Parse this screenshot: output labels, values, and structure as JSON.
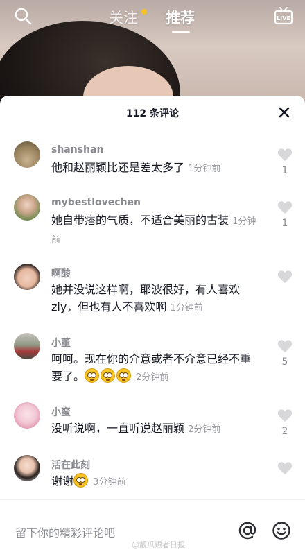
{
  "top_nav": {
    "tabs": [
      {
        "label": "关注",
        "has_dot": true
      },
      {
        "label": "推荐",
        "active": true
      }
    ],
    "icons": [
      "search-icon",
      "live-icon"
    ],
    "dot_color": "#f6c324"
  },
  "comments_sheet": {
    "count_label": "112 条评论",
    "comments": [
      {
        "username": "shanshan",
        "text": "他和赵丽颖比还是差太多了",
        "time": "1分钟前",
        "likes": "1",
        "emojis": 0
      },
      {
        "username": "mybestlovechen",
        "text": "她自带痞的气质，不适合美丽的古装",
        "time": "1分钟前",
        "likes": "1",
        "emojis": 0
      },
      {
        "username": "啊酸",
        "text": "她并没说这样啊，耶波很好，有人喜欢zly，但也有人不喜欢啊",
        "time": "1分钟前",
        "likes": "",
        "emojis": 0
      },
      {
        "username": "小董",
        "text": "呵呵。现在你的介意或者不介意已经不重要了。",
        "time": "2分钟前",
        "likes": "5",
        "emojis": 3
      },
      {
        "username": "小蛮",
        "text": "没听说啊，一直听说赵丽颖",
        "time": "2分钟前",
        "likes": "2",
        "emojis": 0
      },
      {
        "username": "活在此刻",
        "text": "谢谢",
        "time": "3分钟前",
        "likes": "",
        "emojis": 1
      }
    ]
  },
  "input_bar": {
    "placeholder": "留下你的精彩评论吧",
    "watermark": "@靓瓜赐者日报"
  },
  "colors": {
    "accent": "#f6c324",
    "text_primary": "#161823",
    "text_secondary": "#8a8b91"
  }
}
